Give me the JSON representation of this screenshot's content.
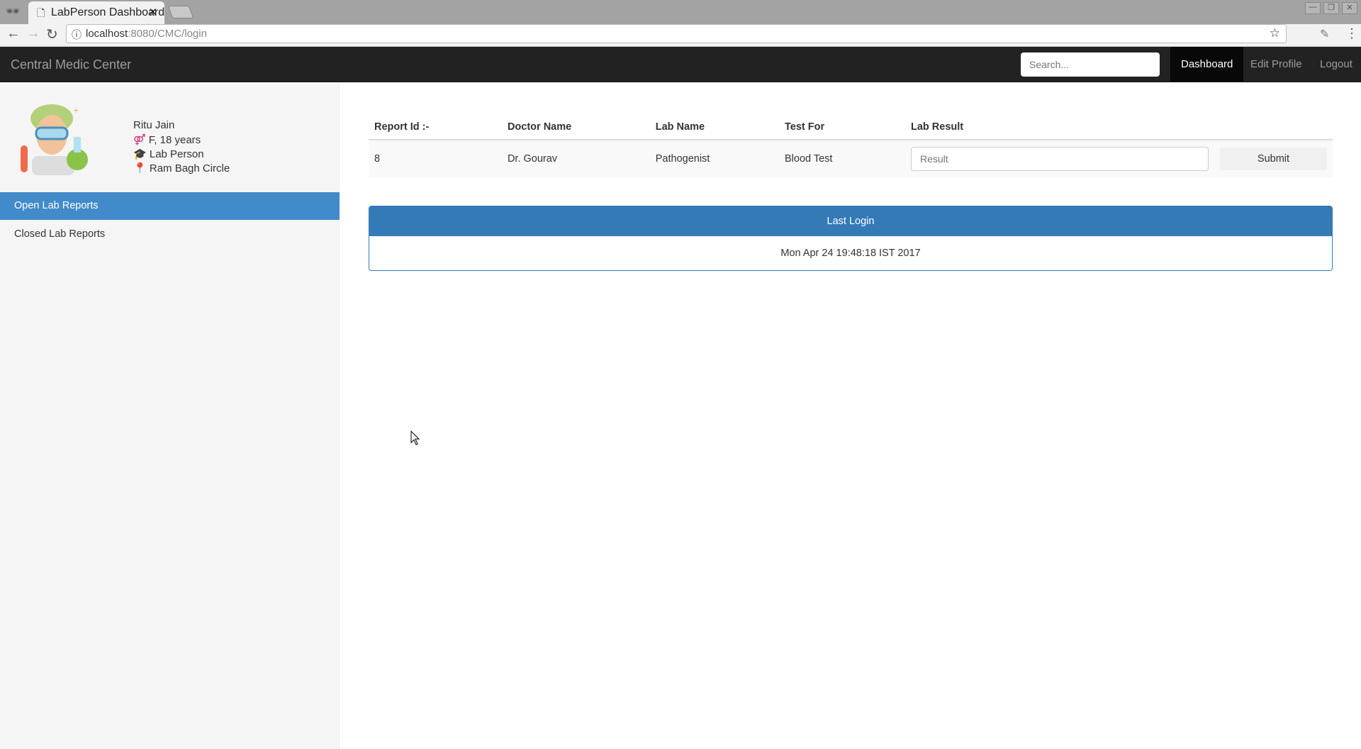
{
  "browser": {
    "tab_title": "LabPerson Dashboard",
    "url_host": "localhost",
    "url_rest": ":8080/CMC/login"
  },
  "navbar": {
    "brand": "Central Medic Center",
    "search_placeholder": "Search...",
    "links": [
      "Dashboard",
      "Edit Profile",
      "Logout"
    ],
    "active": "Dashboard"
  },
  "profile": {
    "name": "Ritu Jain",
    "gender_age": "F, 18 years",
    "role": "Lab Person",
    "location": "Ram Bagh Circle"
  },
  "sidebar": {
    "items": [
      "Open Lab Reports",
      "Closed Lab Reports"
    ],
    "active": "Open Lab Reports"
  },
  "table": {
    "headers": [
      "Report Id :-",
      "Doctor Name",
      "Lab Name",
      "Test For",
      "Lab Result"
    ],
    "rows": [
      {
        "id": "8",
        "doctor": "Dr. Gourav",
        "lab": "Pathogenist",
        "test": "Blood Test",
        "result_placeholder": "Result",
        "submit": "Submit"
      }
    ]
  },
  "last_login": {
    "title": "Last Login",
    "value": "Mon Apr 24 19:48:18 IST 2017"
  },
  "colors": {
    "primary": "#337ab7",
    "sidebar_active": "#428bca",
    "navbar": "#222222"
  }
}
